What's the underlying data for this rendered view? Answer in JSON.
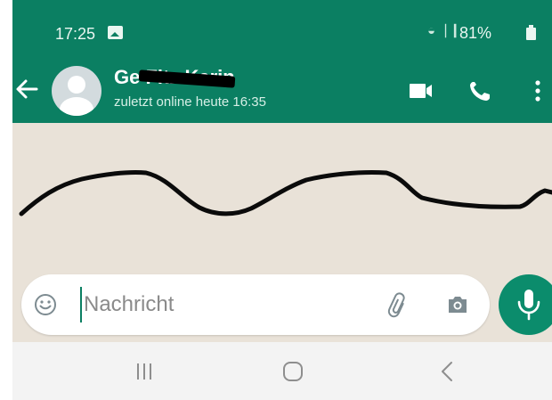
{
  "statusbar": {
    "time": "17:25",
    "battery": "81%",
    "notification_icon": "gallery-icon",
    "wifi_icon": "wifi-icon",
    "signal_icon": "signal-icon",
    "battery_icon": "battery-icon"
  },
  "chat_header": {
    "back_icon": "arrow-left-icon",
    "contact_name": "Ge       Fitz Karin",
    "contact_status": "zuletzt online heute 16:35",
    "avatar_icon": "default-avatar-icon",
    "video_icon": "video-camera-icon",
    "call_icon": "phone-icon",
    "menu_icon": "more-vert-icon"
  },
  "composer": {
    "placeholder": "Nachricht",
    "emoji_icon": "emoji-icon",
    "attach_icon": "paperclip-icon",
    "camera_icon": "camera-icon",
    "mic_icon": "microphone-icon"
  },
  "navigation": {
    "recents_icon": "recents-icon",
    "home_icon": "home-icon",
    "back_icon": "back-chevron-icon"
  },
  "colors": {
    "header": "#0b7f62",
    "chat_background": "#e9e2d8",
    "mic_button": "#0b8c6c",
    "navbar": "#f3f3f3"
  }
}
